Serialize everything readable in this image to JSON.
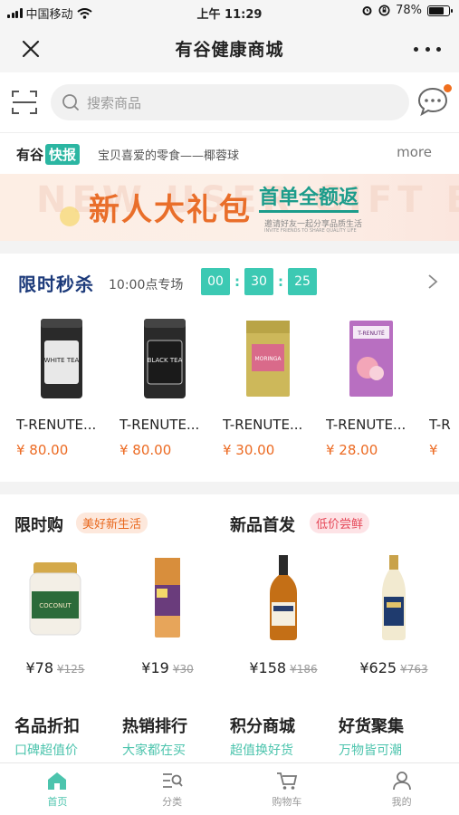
{
  "status_bar": {
    "carrier": "中国移动",
    "time": "上午 11:29",
    "battery": "78%",
    "battery_level": 0.78
  },
  "nav": {
    "title": "有谷健康商城"
  },
  "search": {
    "placeholder": "搜索商品"
  },
  "news": {
    "brand": "有谷",
    "badge": "快报",
    "text": "宝贝喜爱的零食——椰蓉球",
    "more": "more"
  },
  "banner": {
    "bg_text": "NEW USER GIFT BAG",
    "main": "新人大礼包",
    "sub": "首单全额返",
    "small": "邀请好友一起分享品质生活",
    "tiny": "INVITE FRIENDS TO SHARE QUALITY LIFE"
  },
  "flash_sale": {
    "title": "限时秒杀",
    "session": "10:00点专场",
    "countdown": {
      "hours": "00",
      "minutes": "30",
      "seconds": "25"
    },
    "items": [
      {
        "name": "T-RENUTE...",
        "price": "¥ 80.00",
        "label": "WHITE TEA"
      },
      {
        "name": "T-RENUTE...",
        "price": "¥ 80.00",
        "label": "BLACK TEA"
      },
      {
        "name": "T-RENUTE...",
        "price": "¥ 30.00",
        "label": "MORINGA"
      },
      {
        "name": "T-RENUTE...",
        "price": "¥ 28.00",
        "label": "T-RENUTÉ"
      },
      {
        "name": "T-R",
        "price": "¥",
        "label": ""
      }
    ]
  },
  "groups": [
    {
      "title": "限时购",
      "tag": "美好新生活"
    },
    {
      "title": "新品首发",
      "tag": "低价尝鲜"
    }
  ],
  "products": [
    {
      "price": "¥78",
      "old_price": "¥125",
      "label": "COCONUT"
    },
    {
      "price": "¥19",
      "old_price": "¥30",
      "label": ""
    },
    {
      "price": "¥158",
      "old_price": "¥186",
      "label": ""
    },
    {
      "price": "¥625",
      "old_price": "¥763",
      "label": ""
    }
  ],
  "categories": [
    {
      "title": "名品折扣",
      "sub": "口碑超值价"
    },
    {
      "title": "热销排行",
      "sub": "大家都在买"
    },
    {
      "title": "积分商城",
      "sub": "超值换好货"
    },
    {
      "title": "好货聚集",
      "sub": "万物皆可潮"
    }
  ],
  "tabs": [
    {
      "label": "首页",
      "icon": "home-icon",
      "active": true
    },
    {
      "label": "分类",
      "icon": "category-icon",
      "active": false
    },
    {
      "label": "购物车",
      "icon": "cart-icon",
      "active": false
    },
    {
      "label": "我的",
      "icon": "profile-icon",
      "active": false
    }
  ],
  "colors": {
    "accent": "#4cc4ad",
    "price": "#ec6a22",
    "flash_title": "#1c3a7a",
    "notify": "#f06f1e"
  }
}
